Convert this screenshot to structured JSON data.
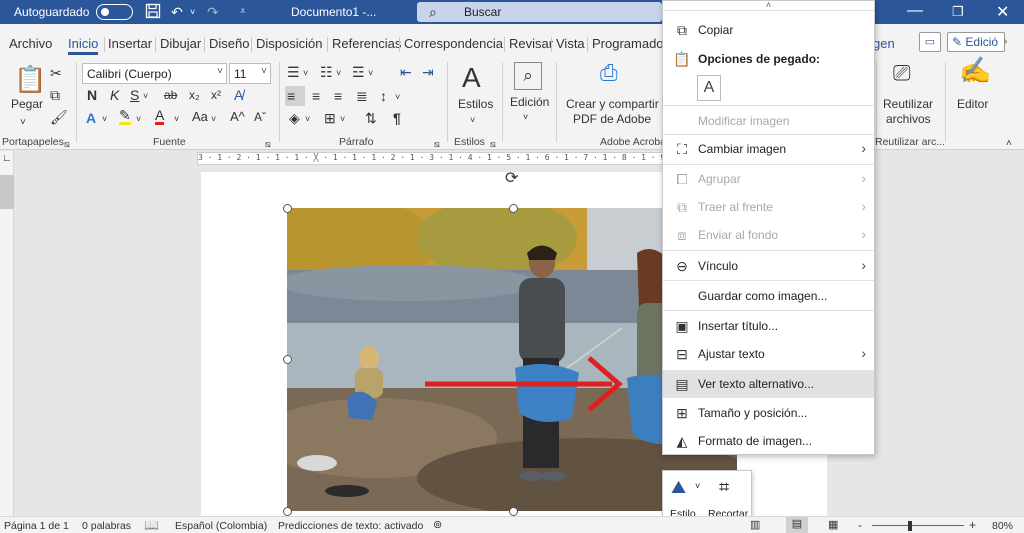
{
  "titlebar": {
    "autosave_label": "Autoguardado",
    "doc_title": "Documento1  -...",
    "search_placeholder": "Buscar"
  },
  "tabs": [
    "Archivo",
    "Inicio",
    "Insertar",
    "Dibujar",
    "Diseño",
    "Disposición",
    "Referencias",
    "Correspondencia",
    "Revisar",
    "Vista",
    "Programado"
  ],
  "tabs_right": {
    "partial_tab": "gen",
    "edit_button": "Edició"
  },
  "ribbon": {
    "clipboard": {
      "paste_label": "Pegar",
      "group_label": "Portapapeles"
    },
    "font": {
      "font_name": "Calibri (Cuerpo)",
      "font_size": "11",
      "bold": "N",
      "italic": "K",
      "underline": "S",
      "strike": "ab",
      "sub": "x₂",
      "sup": "x²",
      "text_effects": "A",
      "font_color": "A",
      "change_case": "Aa",
      "grow": "A^",
      "shrink": "Aˇ",
      "group_label": "Fuente"
    },
    "paragraph": {
      "group_label": "Párrafo",
      "pilcrow": "¶"
    },
    "styles": {
      "label": "Estilos",
      "group_label": "Estilos"
    },
    "editing": {
      "label": "Edición"
    },
    "adobe": {
      "label_line1": "Crear y compartir",
      "label_line2": "PDF de Adobe",
      "group_label": "Adobe Acroba"
    },
    "reuse": {
      "label_line1": "Reutilizar",
      "label_line2": "archivos",
      "group_label": "Reutilizar arc..."
    },
    "editor": {
      "label": "Editor"
    }
  },
  "ruler_text": "3 · 1 · 2 · 1 · 1 · 1 · ╳ · 1 · 1 · 1 · 2 · 1 · 3 · 1 · 4 · 1 · 5 · 1 · 6 · 1 · 7 · 1 · 8 · 1 · 9 · 1 · 10 · 1 · 11 · 1 · 12 · 1 · 13 · 1 · 14 · 1 · 15",
  "context_menu": {
    "items": [
      {
        "label": "Copiar",
        "icon": "copy-icon",
        "disabled": false,
        "submenu": false
      },
      {
        "label": "Opciones de pegado:",
        "icon": "paste-icon",
        "disabled": false,
        "submenu": false,
        "bold": true
      },
      {
        "label": "Modificar imagen",
        "icon": "",
        "disabled": true,
        "submenu": false
      },
      {
        "label": "Cambiar imagen",
        "icon": "change-picture-icon",
        "disabled": false,
        "submenu": true
      },
      {
        "label": "Agrupar",
        "icon": "group-icon",
        "disabled": true,
        "submenu": true
      },
      {
        "label": "Traer al frente",
        "icon": "bring-front-icon",
        "disabled": true,
        "submenu": true
      },
      {
        "label": "Enviar al fondo",
        "icon": "send-back-icon",
        "disabled": true,
        "submenu": true
      },
      {
        "label": "Vínculo",
        "icon": "link-icon",
        "disabled": false,
        "submenu": true
      },
      {
        "label": "Guardar como imagen...",
        "icon": "",
        "disabled": false,
        "submenu": false
      },
      {
        "label": "Insertar título...",
        "icon": "insert-caption-icon",
        "disabled": false,
        "submenu": false
      },
      {
        "label": "Ajustar texto",
        "icon": "wrap-text-icon",
        "disabled": false,
        "submenu": true
      },
      {
        "label": "Ver texto alternativo...",
        "icon": "alt-text-icon",
        "disabled": false,
        "submenu": false,
        "highlighted": true
      },
      {
        "label": "Tamaño y posición...",
        "icon": "size-position-icon",
        "disabled": false,
        "submenu": false
      },
      {
        "label": "Formato de imagen...",
        "icon": "format-picture-icon",
        "disabled": false,
        "submenu": false
      }
    ]
  },
  "mini_toolbar": {
    "style_label": "Estilo",
    "crop_label": "Recortar"
  },
  "statusbar": {
    "page": "Página 1 de 1",
    "words": "0 palabras",
    "language": "Español (Colombia)",
    "predictions": "Predicciones de texto: activado",
    "zoom_minus": "-",
    "zoom_plus": "+",
    "zoom": "80%"
  },
  "colors": {
    "brand": "#2b579a",
    "menu_highlight": "#e1e1e1",
    "arrow": "#e02020"
  }
}
